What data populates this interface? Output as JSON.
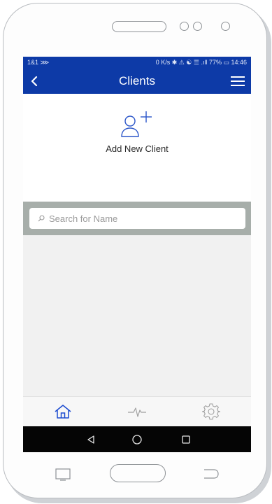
{
  "status_bar": {
    "carrier": "1&1 ⋙",
    "indicators": "0 K/s ✱ ⚠ ☯ ☰ .ıll 77% ▭ 14:46"
  },
  "app_bar": {
    "title": "Clients",
    "back_icon": "chevron-left-icon",
    "menu_icon": "hamburger-menu-icon"
  },
  "add_client": {
    "label": "Add New Client",
    "icon": "add-user-icon"
  },
  "search": {
    "placeholder": "Search for Name",
    "value": "",
    "icon": "search-icon"
  },
  "bottom_nav": {
    "items": [
      {
        "icon": "home-icon",
        "active": true
      },
      {
        "icon": "activity-pulse-icon",
        "active": false
      },
      {
        "icon": "settings-gear-icon",
        "active": false
      }
    ]
  },
  "system_nav": {
    "items": [
      "back-triangle-icon",
      "home-circle-icon",
      "recents-square-icon"
    ]
  },
  "colors": {
    "primary": "#0d3aa7",
    "search_band": "#a7aeaa",
    "background": "#f1f1f1",
    "nav_active": "#1c4bd0",
    "nav_inactive": "#a0a0a0"
  }
}
